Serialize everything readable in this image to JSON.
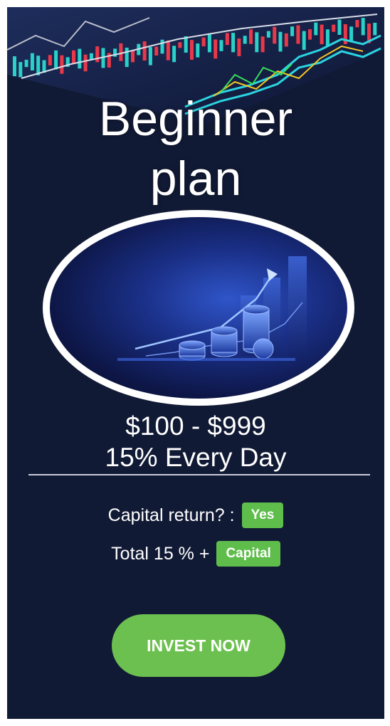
{
  "plan": {
    "title_line1": "Beginner",
    "title_line2": "plan",
    "price_range": "$100 - $999",
    "rate": "15% Every Day"
  },
  "details": {
    "capital_return_label": "Capital return? :",
    "capital_return_value": "Yes",
    "total_label": "Total 15 % +",
    "total_badge": "Capital"
  },
  "cta": {
    "label": "INVEST NOW"
  },
  "colors": {
    "background": "#111a35",
    "accent_green": "#6cc04f",
    "text": "#ffffff"
  }
}
